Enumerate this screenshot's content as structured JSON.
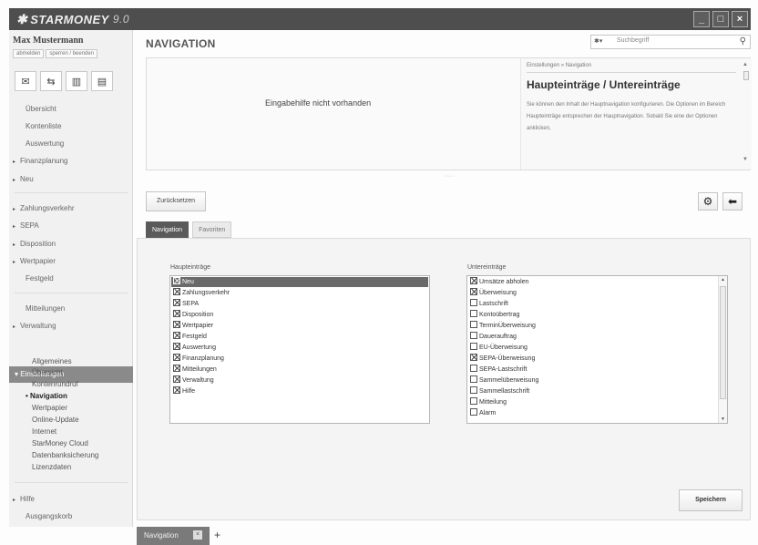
{
  "app": {
    "brand": "STARMONEY",
    "version": "9.0"
  },
  "window_controls": {
    "minimize": "_",
    "maximize": "□",
    "close": "×"
  },
  "sidebar": {
    "user_name": "Max Mustermann",
    "account_links": [
      "abmelden",
      "sperren / beenden"
    ],
    "quick_icons": [
      "mail-icon",
      "transfer-icon",
      "chart-icon",
      "document-icon"
    ],
    "nav": [
      {
        "label": "Übersicht"
      },
      {
        "label": "Kontenliste"
      },
      {
        "label": "Auswertung"
      },
      {
        "label": "Finanzplanung"
      },
      {
        "label": "Neu"
      },
      {
        "label": "Zahlungsverkehr"
      },
      {
        "label": "SEPA"
      },
      {
        "label": "Disposition"
      },
      {
        "label": "Wertpapier"
      },
      {
        "label": "Festgeld"
      },
      {
        "label": "Mitteilungen"
      },
      {
        "label": "Verwaltung"
      },
      {
        "label": "Einstellungen"
      },
      {
        "label": "Hilfe"
      },
      {
        "label": "Ausgangskorb"
      }
    ],
    "settings_items": [
      {
        "label": "Allgemeines"
      },
      {
        "label": "Übersicht"
      },
      {
        "label": "Kontenrundruf"
      },
      {
        "label": "Navigation"
      },
      {
        "label": "Wertpapier"
      },
      {
        "label": "Online-Update"
      },
      {
        "label": "Internet"
      },
      {
        "label": "StarMoney Cloud"
      },
      {
        "label": "Datenbanksicherung"
      },
      {
        "label": "Lizenzdaten"
      }
    ]
  },
  "main": {
    "title": "NAVIGATION",
    "search": {
      "placeholder": "Suchbegriff",
      "scope": "▾"
    },
    "help": {
      "empty_text": "Eingabehilfe nicht vorhanden",
      "breadcrumb": "Einstellungen » Navigation",
      "title": "Haupteinträge / Untereinträge",
      "text": "Sie können den Inhalt der Hauptnavigation konfigurieren. Die Optionen im Bereich Haupteinträge entsprechen der Hauptnavigation. Sobald Sie eine der Optionen anklicken,"
    },
    "reset_label": "Zurücksetzen",
    "tabs": [
      {
        "label": "Navigation"
      },
      {
        "label": "Favoriten"
      }
    ],
    "main_entries": {
      "label": "Haupteinträge",
      "items": [
        {
          "label": "Neu",
          "checked": true
        },
        {
          "label": "Zahlungsverkehr",
          "checked": true
        },
        {
          "label": "SEPA",
          "checked": true
        },
        {
          "label": "Disposition",
          "checked": true
        },
        {
          "label": "Wertpapier",
          "checked": true
        },
        {
          "label": "Festgeld",
          "checked": true
        },
        {
          "label": "Auswertung",
          "checked": true
        },
        {
          "label": "Finanzplanung",
          "checked": true
        },
        {
          "label": "Mitteilungen",
          "checked": true
        },
        {
          "label": "Verwaltung",
          "checked": true
        },
        {
          "label": "Hilfe",
          "checked": true
        }
      ]
    },
    "sub_entries": {
      "label": "Untereinträge",
      "items": [
        {
          "label": "Umsätze abholen",
          "checked": true
        },
        {
          "label": "Überweisung",
          "checked": true
        },
        {
          "label": "Lastschrift",
          "checked": false
        },
        {
          "label": "Kontoübertrag",
          "checked": false
        },
        {
          "label": "TerminÜberweisung",
          "checked": false
        },
        {
          "label": "Dauerauftrag",
          "checked": false
        },
        {
          "label": "EU-Überweisung",
          "checked": false
        },
        {
          "label": "SEPA-Überweisung",
          "checked": true
        },
        {
          "label": "SEPA-Lastschrift",
          "checked": false
        },
        {
          "label": "Sammelüberweisung",
          "checked": false
        },
        {
          "label": "Sammellastschrift",
          "checked": false
        },
        {
          "label": "Mitteilung",
          "checked": false
        },
        {
          "label": "Alarm",
          "checked": false
        }
      ]
    },
    "save_label": "Speichern"
  },
  "bottom_tabs": [
    {
      "label": "Navigation"
    }
  ],
  "add_tab_label": "+",
  "colors": {
    "titlebar": "#4e4e4e",
    "active_item": "#8a8a8a",
    "selected_row": "#6a6a6a"
  }
}
